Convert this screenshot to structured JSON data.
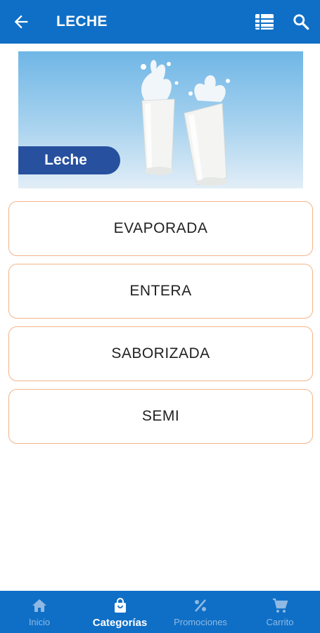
{
  "appbar": {
    "title": "LECHE",
    "back_icon": "arrow-left-icon",
    "list_icon": "list-view-icon",
    "search_icon": "search-icon",
    "background_color": "#0f6fc6"
  },
  "banner": {
    "label": "Leche",
    "image": "milk-glasses-splash",
    "label_color": "#27509e"
  },
  "options": [
    {
      "label": "EVAPORADA"
    },
    {
      "label": "ENTERA"
    },
    {
      "label": "SABORIZADA"
    },
    {
      "label": "SEMI"
    }
  ],
  "option_border_color": "#f2b48a",
  "bottom_nav": [
    {
      "label": "Inicio",
      "icon": "home-icon",
      "active": false
    },
    {
      "label": "Categorías",
      "icon": "shopping-bag-icon",
      "active": true
    },
    {
      "label": "Promociones",
      "icon": "percent-icon",
      "active": false
    },
    {
      "label": "Carrito",
      "icon": "cart-icon",
      "active": false
    }
  ]
}
